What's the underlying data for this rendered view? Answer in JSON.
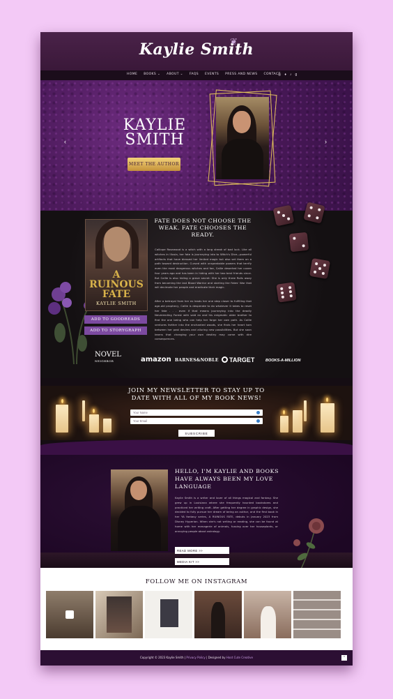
{
  "header": {
    "logo_text": "Kaylie Smith",
    "nav": [
      "HOME",
      "BOOKS ⌄",
      "ABOUT ⌄",
      "FAQS",
      "EVENTS",
      "PRESS AND NEWS",
      "CONTACT"
    ],
    "socials": [
      "instagram-icon",
      "twitter-icon",
      "tiktok-icon",
      "goodreads-icon"
    ]
  },
  "hero": {
    "title_line1": "KAYLIE",
    "title_line2": "SMITH",
    "button": "MEET THE AUTHOR",
    "prev": "‹",
    "next": "›"
  },
  "book": {
    "cover_title_line1": "A",
    "cover_title_line2": "RUINOUS",
    "cover_title_line3": "FATE",
    "cover_author": "KAYLIE SMITH",
    "btn_goodreads": "ADD TO GOODREADS",
    "btn_storygraph": "ADD TO STORYGRAPH",
    "tagline": "FATE DOES NOT CHOOSE THE WEAK. FATE CHOOSES THE READY.",
    "blurb1": "Calliope Rosewood is a witch with a long streak of bad luck. Like all witches in Illusia, her fate is journeying into to Witch's Dice—powerful artifacts that have blessed her limited magic but also set them on a path toward destruction. Cursed with unspeakable powers that terrify even the most dangerous witches and fae, Callie deserted her coven four years ago and has been in hiding with her two best friends since. But Callie is also hiding a grave secret: She is only three Rolls away from becoming the last Blood Warrior and starting the Fates' War that will decimate her people and eradicate their magic.",
    "blurb2": "After a betrayal from her ex leads her one step closer to fulfilling that age-old prophecy, Callie is desperate to do whatever it takes to reset her fate . . . even if that means journeying into the deadly Neverending Forest with said ex and his enigmatic older brother to find the one being who can help her forge her own path. As Callie ventures farther into the enchanted woods, she finds her heart torn between her past desires and alluring new possibilities. But she soon learns that changing your own destiny may come with dire consequences.",
    "retailers": {
      "novel": "NOVEL",
      "novel_sub": "NEIGHBOR",
      "amazon": "amazon",
      "bn": "BARNES&NOBLE",
      "target": "TARGET",
      "bam": "BOOKS-A-MILLION"
    }
  },
  "newsletter": {
    "title": "JOIN MY NEWSLETTER TO STAY UP TO DATE WITH ALL OF MY BOOK NEWS!",
    "name_placeholder": "Your Name",
    "email_placeholder": "Your Email",
    "button": "SUBSCRIBE"
  },
  "about": {
    "title": "HELLO, I'M KAYLIE AND BOOKS HAVE ALWAYS BEEN MY LOVE LANGUAGE",
    "text": "Kaylie Smith is a writer and lover of all things magical and fantasy. She grew up in Louisiana where she frequently haunted bookstores and practiced her writing craft. After getting her degree in graphic design, she decided to fully pursue her dream of being an author, and the first book in her YA fantasy series, A RUINOUS FATE, debuts in January 2023 from Disney Hyperion. When she's not writing or reading, she can be found at home with her menagerie of animals, fussing over her houseplants, or annoying people about astrology.",
    "read_more": "READ MORE >>",
    "media_kit": "MEDIA KIT >>"
  },
  "instagram": {
    "title": "FOLLOW ME ON INSTAGRAM"
  },
  "footer": {
    "copyright": "Copyright © 2023 Kaylie Smith | ",
    "privacy": "Privacy Policy",
    "designed": " | Designed by ",
    "designer": "Hoot Cute Creative",
    "to_top": "⌃"
  },
  "colors": {
    "page_bg": "#f3c9f6",
    "header": "#3a1839",
    "accent_gold": "#d9b04a",
    "button_purple": "#7c4aa0",
    "footer": "#2c0f33"
  }
}
